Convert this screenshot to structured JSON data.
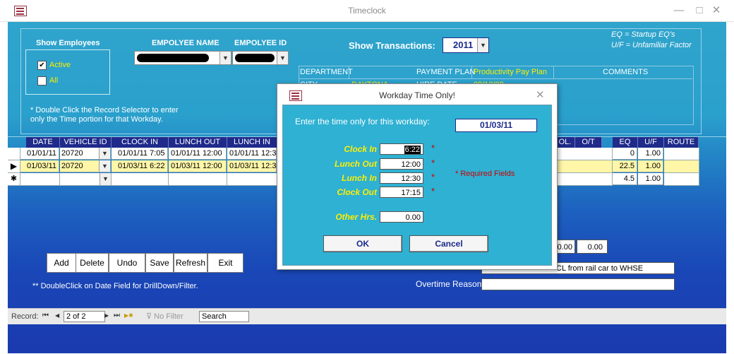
{
  "window": {
    "title": "Timeclock",
    "minimize": "—",
    "restore": "□",
    "close": "✕"
  },
  "filters": {
    "show_employees_label": "Show Employees",
    "active_label": "Active",
    "all_label": "All",
    "active_checked": "✔",
    "employee_name_label": "EMPOLYEE NAME",
    "employee_id_label": "EMPOLYEE ID",
    "hint_line1": "* Double Click the Record Selector to enter",
    "hint_line2": "only the Time portion for that Workday.",
    "show_transactions_label": "Show Transactions:",
    "year": "2011",
    "legend_eq": "EQ = Startup EQ's",
    "legend_uf": "U/F = Unfamiliar Factor"
  },
  "info": {
    "department_label": "DEPARTMENT",
    "payment_plan_label": "PAYMENT PLAN",
    "payment_plan_value": "Productivity Pay Plan",
    "comments_label": "COMMENTS",
    "city_label": "CITY",
    "city_value": "DAYTONA",
    "hire_date_label": "HIRE DATE",
    "hire_date_value": "08/12/09"
  },
  "grid": {
    "headers_left": [
      "DATE",
      "VEHICLE ID",
      "CLOCK IN",
      "LUNCH OUT",
      "LUNCH IN"
    ],
    "headers_right": [
      "OL.",
      "O/T",
      "EQ",
      "U/F",
      "ROUTE"
    ],
    "rows": [
      {
        "date": "01/01/11",
        "vehicle": "20720",
        "clock_in": "01/01/11 7:05",
        "lunch_out": "01/01/11 12:00",
        "lunch_in": "01/01/11 12:3",
        "eq": "0",
        "uf": "1.00"
      },
      {
        "date": "01/03/11",
        "vehicle": "20720",
        "clock_in": "01/03/11 6:22",
        "lunch_out": "01/03/11 12:00",
        "lunch_in": "01/03/11 12:3",
        "eq": "22.5",
        "uf": "1.00"
      },
      {
        "date": "",
        "vehicle": "",
        "clock_in": "",
        "lunch_out": "",
        "lunch_in": "",
        "eq": "4.5",
        "uf": "1.00"
      }
    ],
    "new_row_marker": "✱",
    "current_row_marker": "▶"
  },
  "buttons": {
    "add": "Add",
    "delete": "Delete",
    "undo": "Undo",
    "save": "Save",
    "refresh": "Refresh",
    "exit": "Exit"
  },
  "hint_drilldown": "** DoubleClick on Date Field for DrillDown/Filter.",
  "totals": {
    "a": "0.00",
    "b": "0.00"
  },
  "reason_value": "CL from rail car to WHSE",
  "overtime_reason_label": "Overtime Reason",
  "overtime_reason_value": "",
  "nav": {
    "record_label": "Record:",
    "first": "⏮",
    "prev": "◀",
    "position": "2 of 2",
    "next": "▶",
    "last": "⏭",
    "new": "▶✱",
    "no_filter": "No Filter",
    "search": "Search"
  },
  "dialog": {
    "title": "Workday Time Only!",
    "close": "✕",
    "prompt": "Enter the time only for this workday:",
    "date": "01/03/11",
    "clock_in_label": "Clock In",
    "clock_in": "6:22",
    "lunch_out_label": "Lunch Out",
    "lunch_out": "12:00",
    "lunch_in_label": "Lunch In",
    "lunch_in": "12:30",
    "clock_out_label": "Clock Out",
    "clock_out": "17:15",
    "required_note": "* Required Fields",
    "other_hrs_label": "Other Hrs.",
    "other_hrs": "0.00",
    "ok": "OK",
    "cancel": "Cancel",
    "star": "*"
  },
  "colors": {
    "accent_yellow": "#ffee00",
    "header_navy": "#1f2a8a",
    "form_teal": "#2fa4cc"
  }
}
